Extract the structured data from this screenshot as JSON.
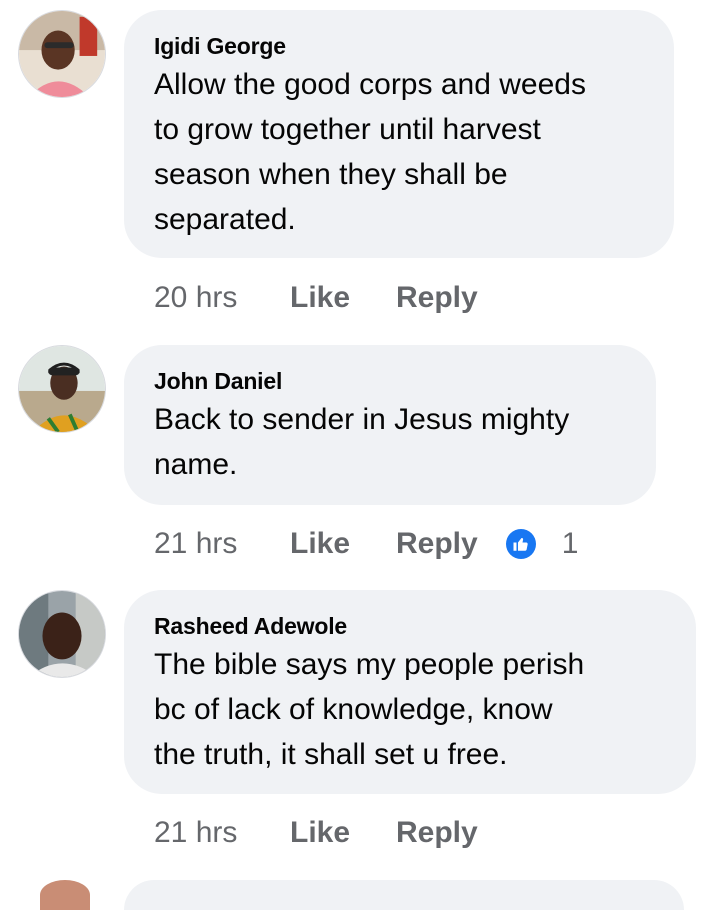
{
  "comments": [
    {
      "author": "Igidi George",
      "text": "Allow the good corps and weeds\nto grow together until harvest\nseason when they shall be\nseparated.",
      "time": "20 hrs",
      "like": "Like",
      "reply": "Reply"
    },
    {
      "author": "John Daniel",
      "text": "Back to sender in Jesus mighty\nname.",
      "time": "21 hrs",
      "like": "Like",
      "reply": "Reply",
      "reactions": {
        "icon": "thumbs-up-icon",
        "count": "1"
      }
    },
    {
      "author": "Rasheed Adewole",
      "text": "The bible  says  my  people  perish\n bc  of  lack  of  knowledge,  know\nthe  truth,  it shall  set  u  free.",
      "time": "21 hrs",
      "like": "Like",
      "reply": "Reply"
    }
  ],
  "colors": {
    "bubble": "#f0f2f5",
    "meta_text": "#65676b",
    "reaction_blue": "#1877f2"
  }
}
